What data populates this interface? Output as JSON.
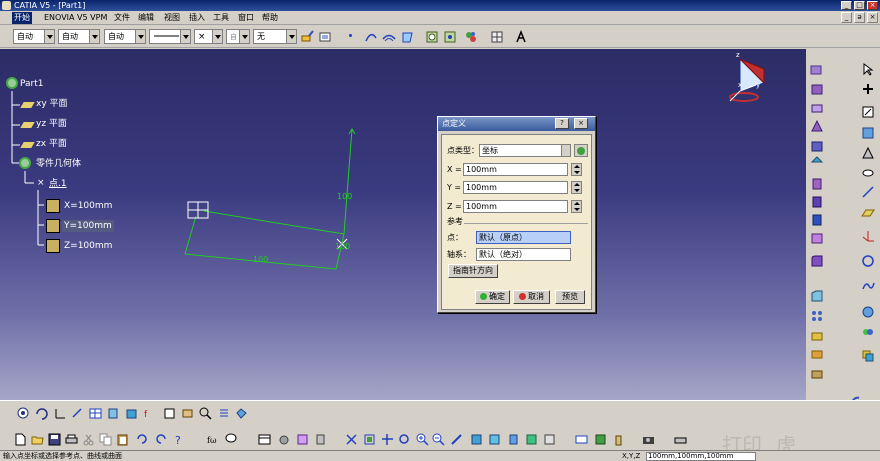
{
  "window": {
    "title": "CATIA V5 - [Part1]",
    "controls": [
      "_",
      "□",
      "×"
    ],
    "mdi_controls": [
      "_",
      "ə",
      "×"
    ]
  },
  "menu": {
    "items": [
      "开始",
      "ENOVIA V5 VPM",
      "文件",
      "编辑",
      "视图",
      "插入",
      "工具",
      "窗口",
      "帮助"
    ]
  },
  "toolbar": {
    "combos": [
      "自动",
      "自动",
      "自动",
      "",
      "",
      "",
      "自动",
      "无"
    ]
  },
  "tree": {
    "root": "Part1",
    "nodes": [
      "xy 平面",
      "yz 平面",
      "zx 平面",
      "零件几何体",
      "点.1"
    ],
    "params": [
      "X=100mm",
      "Y=100mm",
      "Z=100mm"
    ]
  },
  "viewport": {
    "dim_labels": [
      "100",
      "100",
      "100"
    ],
    "compass": {
      "x": "x",
      "y": "y",
      "z": "z"
    }
  },
  "dialog": {
    "title": "点定义",
    "help": "?",
    "close": "×",
    "point_type_label": "点类型：",
    "point_type_value": "坐标",
    "x_label": "X =",
    "x_value": "100mm",
    "y_label": "Y =",
    "y_value": "100mm",
    "z_label": "Z =",
    "z_value": "100mm",
    "reference_label": "参考",
    "point_label": "点：",
    "point_value": "默认（原点）",
    "axis_label": "轴系：",
    "axis_value": "默认（绝对）",
    "compass_button": "指南针方向",
    "ok": "确定",
    "cancel": "取消",
    "preview": "预览"
  },
  "status": {
    "message": "输入点坐标或选择参考点、曲线或曲面",
    "field_label": "X,Y,Z",
    "field_value": "100mm,100mm,100mm"
  },
  "colors": {
    "titlebar": "#0a246a",
    "viewport_top": "#2c2c66",
    "geometry": "#22cc22",
    "dialog_body": "#f2ebd2"
  }
}
